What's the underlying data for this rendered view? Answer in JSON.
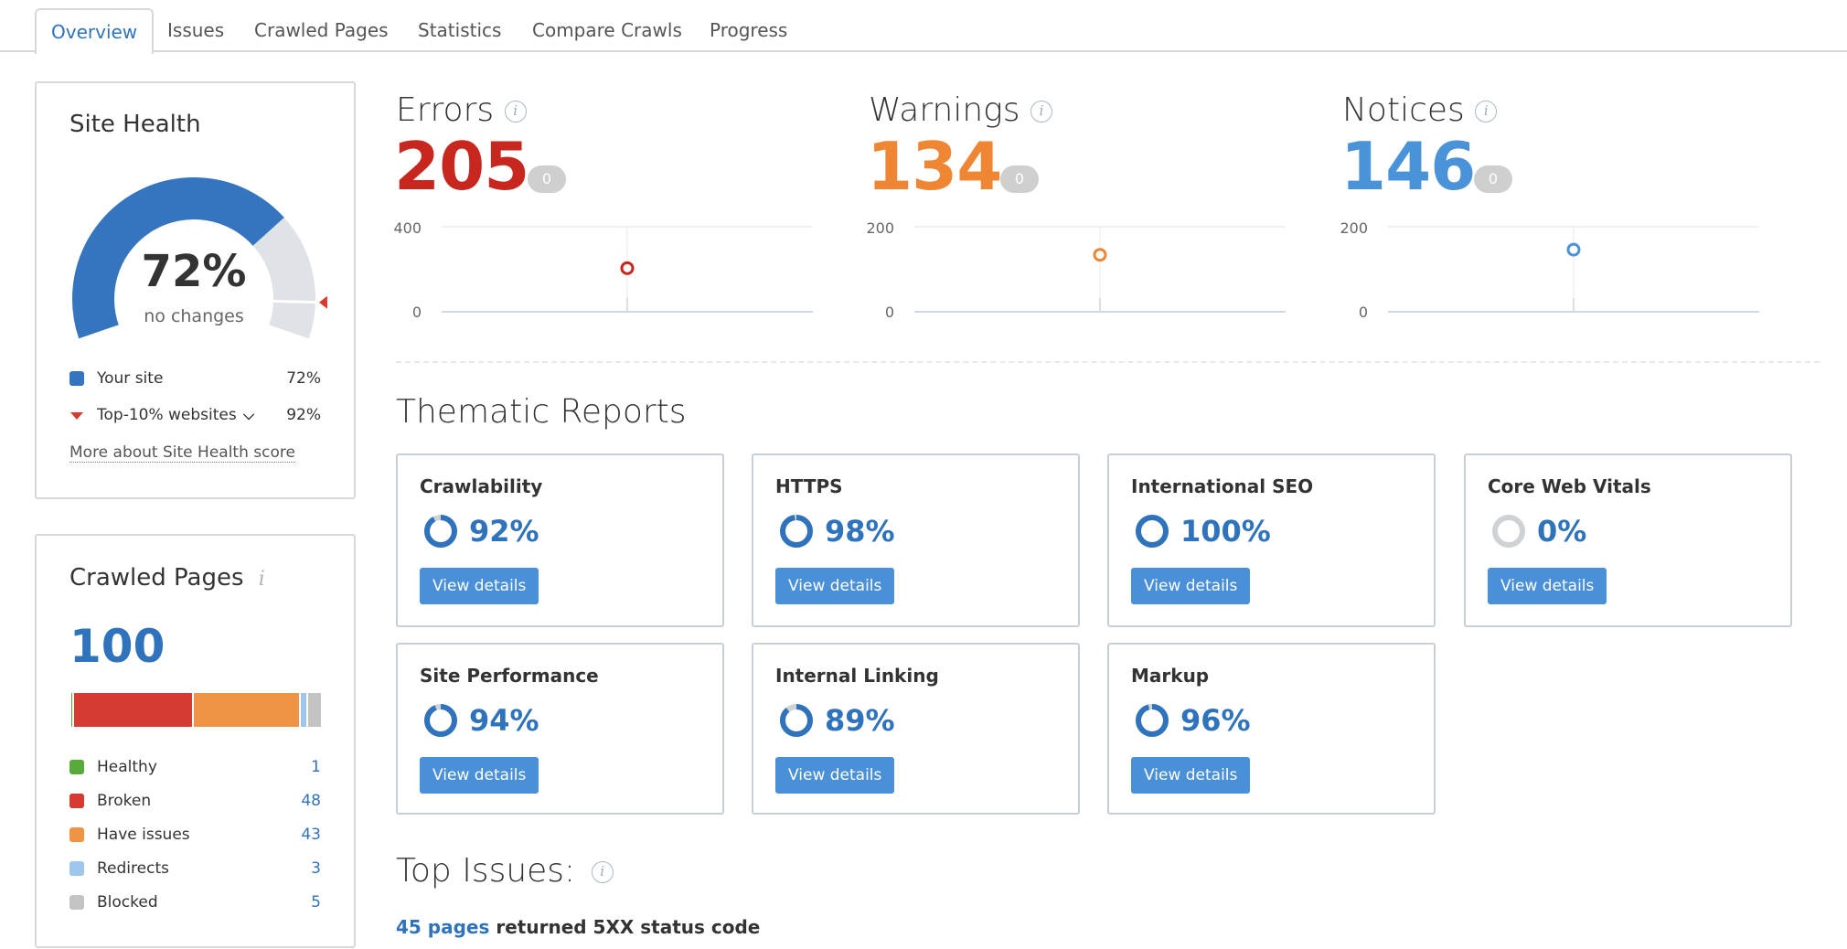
{
  "tabs": [
    {
      "label": "Overview",
      "active": true
    },
    {
      "label": "Issues"
    },
    {
      "label": "Crawled Pages"
    },
    {
      "label": "Statistics"
    },
    {
      "label": "Compare Crawls"
    },
    {
      "label": "Progress"
    }
  ],
  "site_health": {
    "title": "Site Health",
    "score_label": "72%",
    "score": 72,
    "benchmark": 92,
    "change_label": "no changes",
    "legend": [
      {
        "label": "Your site",
        "value": "72%",
        "color": "#3575c0"
      },
      {
        "label": "Top-10% websites",
        "value": "92%",
        "color": "#d63b30"
      }
    ],
    "more_link": "More about Site Health score",
    "colors": {
      "fill": "#3575c0",
      "track": "#dfe2e6",
      "marker": "#d63b30"
    }
  },
  "crawled_pages": {
    "title": "Crawled Pages",
    "total": "100",
    "segments": [
      {
        "label": "Healthy",
        "value": 1,
        "color": "#5aaa3b"
      },
      {
        "label": "Broken",
        "value": 48,
        "color": "#d63a33"
      },
      {
        "label": "Have issues",
        "value": 43,
        "color": "#ef9444"
      },
      {
        "label": "Redirects",
        "value": 3,
        "color": "#9fc6ec"
      },
      {
        "label": "Blocked",
        "value": 5,
        "color": "#c4c4c4"
      }
    ]
  },
  "issues": [
    {
      "key": "errors",
      "title": "Errors",
      "count": "205",
      "delta": "0",
      "color": "#c7271e",
      "ymax_label": "400",
      "ymin_label": "0",
      "ymax": 400,
      "value": 205
    },
    {
      "key": "warnings",
      "title": "Warnings",
      "count": "134",
      "delta": "0",
      "color": "#ef8634",
      "ymax_label": "200",
      "ymin_label": "0",
      "ymax": 200,
      "value": 134
    },
    {
      "key": "notices",
      "title": "Notices",
      "count": "146",
      "delta": "0",
      "color": "#4a93d8",
      "ymax_label": "200",
      "ymin_label": "0",
      "ymax": 200,
      "value": 146
    }
  ],
  "thematic": {
    "title": "Thematic Reports",
    "button_label": "View details",
    "cards": [
      {
        "title": "Crawlability",
        "pct_label": "92%",
        "pct": 92
      },
      {
        "title": "HTTPS",
        "pct_label": "98%",
        "pct": 98
      },
      {
        "title": "International SEO",
        "pct_label": "100%",
        "pct": 100
      },
      {
        "title": "Core Web Vitals",
        "pct_label": "0%",
        "pct": 0
      },
      {
        "title": "Site Performance",
        "pct_label": "94%",
        "pct": 94
      },
      {
        "title": "Internal Linking",
        "pct_label": "89%",
        "pct": 89
      },
      {
        "title": "Markup",
        "pct_label": "96%",
        "pct": 96
      }
    ]
  },
  "top_issues": {
    "title": "Top Issues:",
    "items": [
      {
        "link": "45 pages",
        "text": " returned 5XX status code"
      }
    ]
  }
}
